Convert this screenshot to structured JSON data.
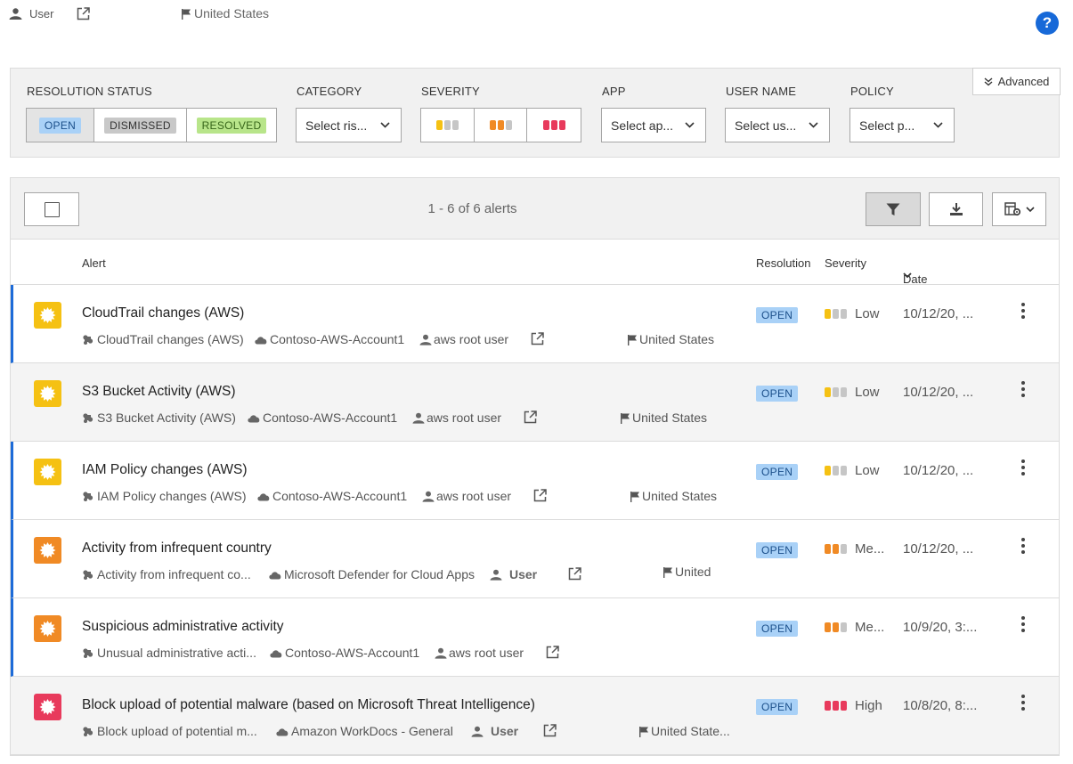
{
  "topbar": {
    "user_label": "User",
    "country": "United States",
    "help_label": "?"
  },
  "filters": {
    "resolution_status": {
      "label": "RESOLUTION STATUS",
      "options": [
        "OPEN",
        "DISMISSED",
        "RESOLVED"
      ],
      "active": "OPEN"
    },
    "category": {
      "label": "CATEGORY",
      "placeholder": "Select ris..."
    },
    "severity": {
      "label": "SEVERITY",
      "options": [
        "low",
        "medium",
        "high"
      ]
    },
    "app": {
      "label": "APP",
      "placeholder": "Select ap..."
    },
    "user_name": {
      "label": "USER NAME",
      "placeholder": "Select us..."
    },
    "policy": {
      "label": "POLICY",
      "placeholder": "Select p..."
    },
    "advanced_label": "Advanced"
  },
  "toolbar": {
    "count_text": "1 - 6 of 6 alerts"
  },
  "columns": {
    "alert": "Alert",
    "resolution": "Resolution",
    "severity": "Severity",
    "date": "Date"
  },
  "colors": {
    "low": "#f5c113",
    "medium": "#f08a25",
    "high": "#e83a5c",
    "bar_off": "#c6c6c6",
    "accent": "#1d6bd8",
    "open_chip": "#a9d1f7"
  },
  "alerts": [
    {
      "title": "CloudTrail changes (AWS)",
      "policy": "CloudTrail changes (AWS)",
      "app": "Contoso-AWS-Account1",
      "user": "aws root user",
      "country": "United States",
      "resolution": "OPEN",
      "severity": "Low",
      "severity_level": 1,
      "date": "10/12/20, ..."
    },
    {
      "title": "S3 Bucket Activity (AWS)",
      "policy": "S3 Bucket Activity (AWS)",
      "app": "Contoso-AWS-Account1",
      "user": "aws root user",
      "country": "United States",
      "resolution": "OPEN",
      "severity": "Low",
      "severity_level": 1,
      "date": "10/12/20, ..."
    },
    {
      "title": "IAM Policy changes (AWS)",
      "policy": "IAM Policy changes (AWS)",
      "app": "Contoso-AWS-Account1",
      "user": "aws root user",
      "country": "United States",
      "resolution": "OPEN",
      "severity": "Low",
      "severity_level": 1,
      "date": "10/12/20, ..."
    },
    {
      "title": "Activity from infrequent country",
      "policy": "Activity from infrequent co...",
      "app": "Microsoft Defender for Cloud Apps",
      "user": "User",
      "country": "United",
      "resolution": "OPEN",
      "severity": "Me...",
      "severity_level": 2,
      "date": "10/12/20, ..."
    },
    {
      "title": "Suspicious administrative activity",
      "policy": "Unusual administrative acti...",
      "app": "Contoso-AWS-Account1",
      "user": "aws root user",
      "country": "",
      "resolution": "OPEN",
      "severity": "Me...",
      "severity_level": 2,
      "date": "10/9/20, 3:..."
    },
    {
      "title": "Block upload of potential malware (based on Microsoft Threat Intelligence)",
      "policy": "Block upload of potential m...",
      "app": "Amazon WorkDocs - General",
      "user": "User",
      "country": "United State...",
      "resolution": "OPEN",
      "severity": "High",
      "severity_level": 3,
      "date": "10/8/20, 8:..."
    }
  ]
}
